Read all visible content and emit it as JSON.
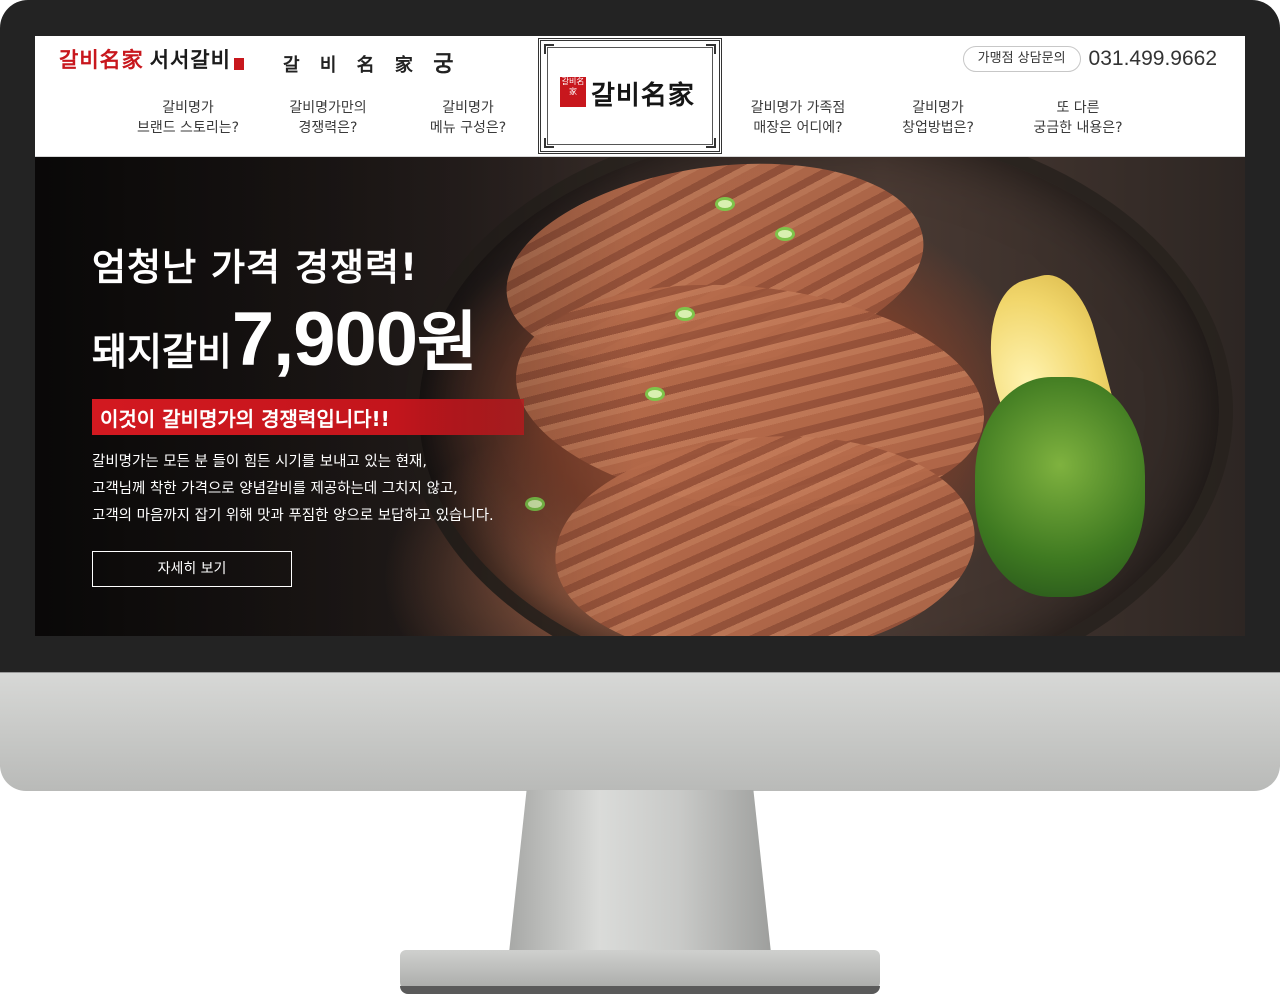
{
  "topbar": {
    "brand_logo_main": "갈비名家",
    "brand_logo_sub": "서서갈비",
    "brand_logo_second": "갈 비 名 家",
    "brand_logo_second_mark": "궁",
    "consult_label": "가맹점 상담문의",
    "phone": "031.499.9662"
  },
  "center_logo": {
    "seal_text": "갈비名家",
    "name": "갈비名家"
  },
  "nav": {
    "items": [
      {
        "line1": "갈비명가",
        "line2": "브랜드 스토리는?"
      },
      {
        "line1": "갈비명가만의",
        "line2": "경쟁력은?"
      },
      {
        "line1": "갈비명가",
        "line2": "메뉴 구성은?"
      },
      {
        "line1": "갈비명가 가족점",
        "line2": "매장은 어디에?"
      },
      {
        "line1": "갈비명가",
        "line2": "창업방법은?"
      },
      {
        "line1": "또 다른",
        "line2": "궁금한 내용은?"
      }
    ]
  },
  "hero": {
    "headline": "엄청난 가격 경쟁력!",
    "product": "돼지갈비",
    "price": "7,900",
    "currency": "원",
    "ribbon": "이것이 갈비명가의 경쟁력입니다!!",
    "description": [
      "갈비명가는 모든 분 들이 힘든 시기를 보내고 있는 현재,",
      "고객님께 착한 가격으로 양념갈비를 제공하는데 그치지 않고,",
      "고객의 마음까지 잡기 위해 맛과 푸짐한 양으로 보답하고 있습니다."
    ],
    "more_button": "자세히 보기"
  },
  "colors": {
    "brand_red": "#c8171d",
    "bezel": "#232323",
    "stand": "#c4c5c3"
  }
}
